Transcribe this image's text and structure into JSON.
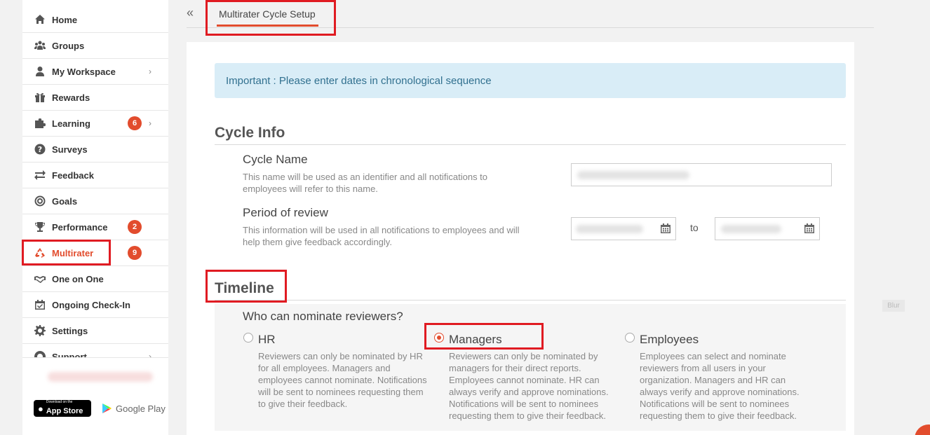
{
  "sidebar": {
    "items": [
      {
        "label": "Home",
        "icon": "home-icon"
      },
      {
        "label": "Groups",
        "icon": "groups-icon"
      },
      {
        "label": "My Workspace",
        "icon": "user-icon"
      },
      {
        "label": "Rewards",
        "icon": "gift-icon"
      },
      {
        "label": "Learning",
        "icon": "puzzle-icon",
        "badge": "6"
      },
      {
        "label": "Surveys",
        "icon": "question-icon"
      },
      {
        "label": "Feedback",
        "icon": "arrows-icon"
      },
      {
        "label": "Goals",
        "icon": "target-icon"
      },
      {
        "label": "Performance",
        "icon": "trophy-icon",
        "badge": "2"
      },
      {
        "label": "Multirater",
        "icon": "recycle-icon",
        "badge": "9"
      },
      {
        "label": "One on One",
        "icon": "handshake-icon"
      },
      {
        "label": "Ongoing Check-In",
        "icon": "calendar-check-icon"
      },
      {
        "label": "Settings",
        "icon": "gear-icon"
      },
      {
        "label": "Support",
        "icon": "lifebuoy-icon"
      }
    ],
    "app_store": {
      "small": "Download on the",
      "big": "App Store"
    },
    "google_play": "Google Play"
  },
  "header": {
    "tab": "Multirater Cycle Setup"
  },
  "alert": "Important : Please enter dates in chronological sequence",
  "cycle_info": {
    "title": "Cycle Info",
    "cycle_name": {
      "label": "Cycle Name",
      "desc": "This name will be used as an identifier and all notifications to employees will refer to this name."
    },
    "period": {
      "label": "Period of review",
      "desc": "This information will be used in all notifications to employees and will help them give feedback accordingly.",
      "to": "to"
    }
  },
  "timeline": {
    "title": "Timeline",
    "nominate_title": "Who can nominate reviewers?",
    "options": [
      {
        "label": "HR",
        "desc": "Reviewers can only be nominated by HR for all employees. Managers and employees cannot nominate. Notifications will be sent to nominees requesting them to give their feedback.",
        "selected": false
      },
      {
        "label": "Managers",
        "desc": "Reviewers can only be nominated by managers for their direct reports. Employees cannot nominate. HR can always verify and approve nominations. Notifications will be sent to nominees requesting them to give their feedback.",
        "selected": true
      },
      {
        "label": "Employees",
        "desc": "Employees can select and nominate reviewers from all users in your organization. Managers and HR can always verify and approve nominations. Notifications will be sent to nominees requesting them to give their feedback.",
        "selected": false
      }
    ]
  },
  "blur_tag": "Blur",
  "colors": {
    "accent": "#e24c2d",
    "highlight": "#e01b22",
    "alert_bg": "#d9edf7",
    "alert_text": "#31708f"
  }
}
